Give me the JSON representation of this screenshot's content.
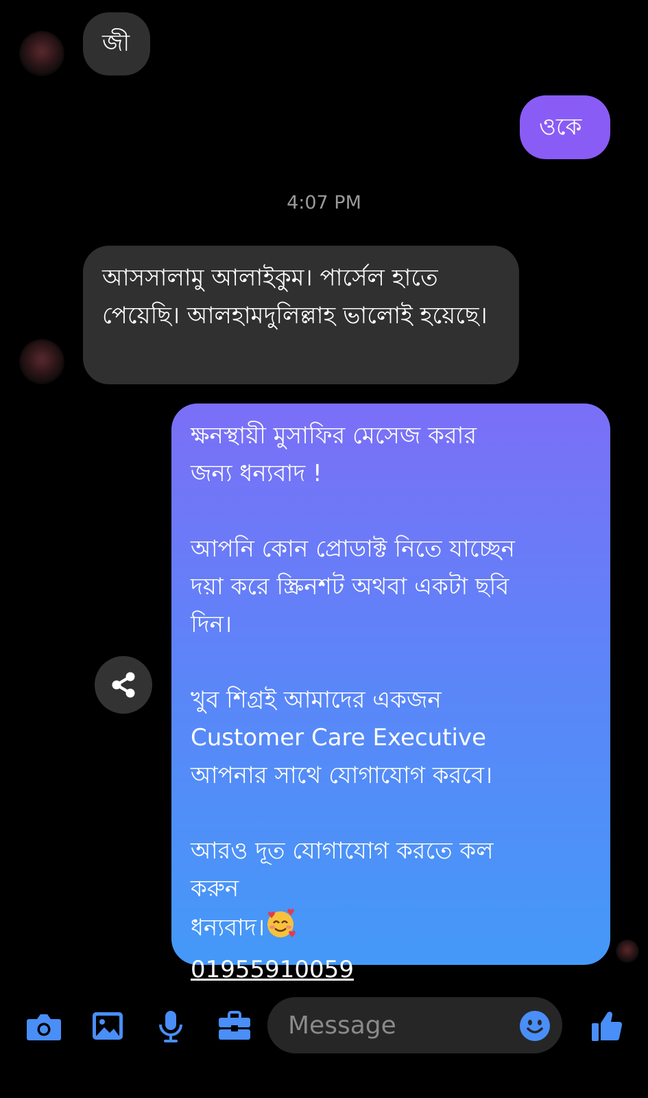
{
  "messages": {
    "m1": {
      "text": "জী"
    },
    "m2": {
      "text": "ওকে"
    },
    "timestamp": "4:07 PM",
    "m3": {
      "text": "আসসালামু আলাইকুম।  পার্সেল হাতে পেয়েছি। আলহামদুলিল্লাহ ভালোই হয়েছে।"
    },
    "m4": {
      "line1": "ক্ষনস্থায়ী মুসাফির  মেসেজ করার",
      "line2": "জন্য ধন্যবাদ !",
      "line3": "আপনি কোন প্রোডাক্ট নিতে যাচ্ছেন",
      "line4": "দয়া করে স্ক্রিনশট অথবা একটা ছবি",
      "line5": "দিন।",
      "line6": "খুব শিগ্রই আমাদের একজন",
      "line7": "Customer Care Executive",
      "line8": "আপনার সাথে যোগাযোগ করবে।",
      "line9": "আরও দূত যোগাযোগ করতে কল",
      "line10": "করুন",
      "line11": "ধন্যবাদ।",
      "phone": "01955910059"
    }
  },
  "composer": {
    "placeholder": "Message"
  },
  "icons": {
    "camera": "camera-icon",
    "gallery": "gallery-icon",
    "microphone": "microphone-icon",
    "briefcase": "briefcase-icon",
    "emoji": "emoji-icon",
    "like": "thumbs-up-icon",
    "share": "share-icon"
  },
  "colors": {
    "accent": "#4a8ef7",
    "sent_solid": "#8a5cf6",
    "gradient_top": "#7b6ff7",
    "gradient_bottom": "#4499f8",
    "received_bubble": "#303030"
  }
}
